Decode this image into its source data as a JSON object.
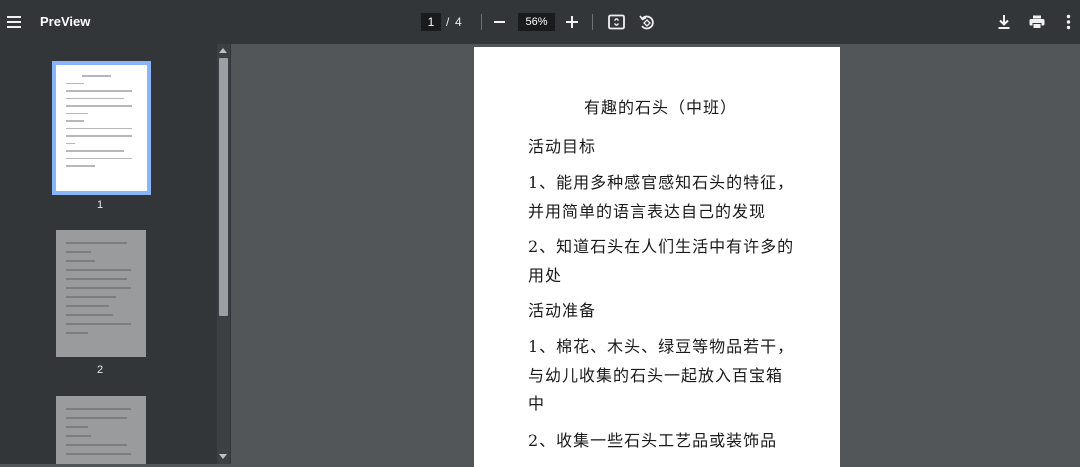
{
  "toolbar": {
    "app_title": "PreView",
    "current_page": "1",
    "page_separator": "/",
    "total_pages": "4",
    "zoom": "56%",
    "icons": [
      "menu-icon",
      "fit-page-icon",
      "rotate-icon",
      "download-icon",
      "print-icon",
      "more-vert-icon"
    ]
  },
  "thumbnails": [
    {
      "label": "1",
      "selected": true
    },
    {
      "label": "2",
      "selected": false
    }
  ],
  "document": {
    "title": "有趣的石头（中班）",
    "lines": [
      "活动目标",
      "1、能用多种感官感知石头的特征，",
      "并用简单的语言表达自己的发现",
      "2、知道石头在人们生活中有许多的",
      "用处",
      "活动准备",
      "1、棉花、木头、绿豆等物品若干，",
      "与幼儿收集的石头一起放入百宝箱",
      "中",
      "2、收集一些石头工艺品或装饰品"
    ]
  },
  "colors": {
    "toolbar_bg": "#323639",
    "viewer_bg": "#525659",
    "selected_thumb_border": "#8ab4f8"
  }
}
